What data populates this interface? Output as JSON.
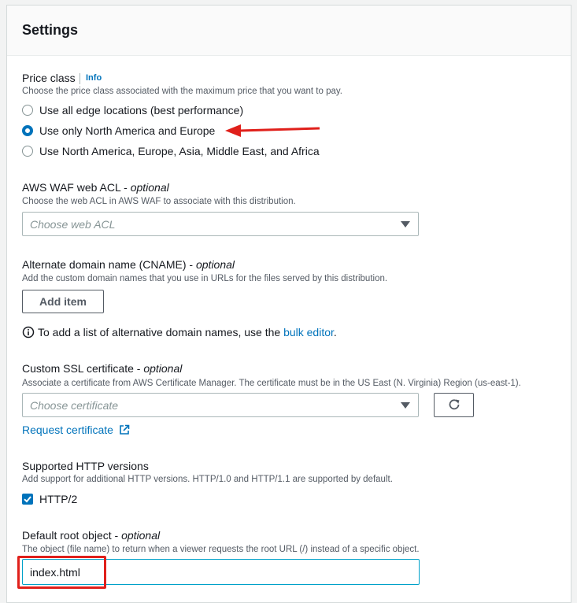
{
  "settings": {
    "title": "Settings",
    "price_class": {
      "label": "Price class",
      "info_link": "Info",
      "description": "Choose the price class associated with the maximum price that you want to pay.",
      "options": [
        {
          "label": "Use all edge locations (best performance)",
          "selected": false
        },
        {
          "label": "Use only North America and Europe",
          "selected": true
        },
        {
          "label": "Use North America, Europe, Asia, Middle East, and Africa",
          "selected": false
        }
      ]
    },
    "waf": {
      "label": "AWS WAF web ACL",
      "optional": "optional",
      "description": "Choose the web ACL in AWS WAF to associate with this distribution.",
      "placeholder": "Choose web ACL"
    },
    "cname": {
      "label": "Alternate domain name (CNAME)",
      "optional": "optional",
      "description": "Add the custom domain names that you use in URLs for the files served by this distribution.",
      "add_button": "Add item",
      "hint_prefix": "To add a list of alternative domain names, use the",
      "hint_link": "bulk editor",
      "hint_suffix": "."
    },
    "ssl": {
      "label": "Custom SSL certificate",
      "optional": "optional",
      "description": "Associate a certificate from AWS Certificate Manager. The certificate must be in the US East (N. Virginia) Region (us-east-1).",
      "placeholder": "Choose certificate",
      "request_link": "Request certificate"
    },
    "http": {
      "label": "Supported HTTP versions",
      "description": "Add support for additional HTTP versions. HTTP/1.0 and HTTP/1.1 are supported by default.",
      "checkbox_label": "HTTP/2",
      "checked": true
    },
    "root_object": {
      "label": "Default root object",
      "optional": "optional",
      "description": "The object (file name) to return when a viewer requests the root URL (/) instead of a specific object.",
      "value": "index.html"
    }
  },
  "colors": {
    "accent": "#0073bb",
    "annotation": "#e0201b"
  }
}
